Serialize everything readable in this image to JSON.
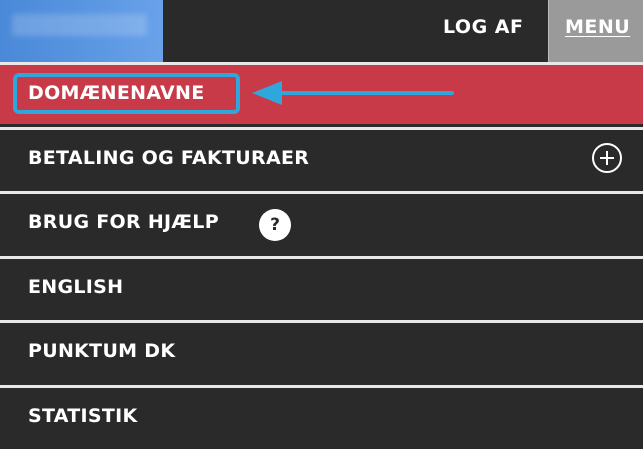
{
  "header": {
    "logout_label": "LOG AF",
    "menu_label": "MENU"
  },
  "nav": {
    "items": [
      {
        "label": "DOMÆNENAVNE",
        "active": true
      },
      {
        "label": "BETALING OG FAKTURAER",
        "expand_icon": "plus-circle-icon"
      },
      {
        "label": "BRUG FOR HJÆLP",
        "help_icon_text": "?"
      },
      {
        "label": "ENGLISH"
      },
      {
        "label": "PUNKTUM DK"
      },
      {
        "label": "STATISTIK"
      }
    ]
  },
  "annotation": {
    "highlight_color": "#2fa7dc",
    "arrow_icon": "left-arrow-icon"
  },
  "colors": {
    "active_bg": "#c83a48",
    "menu_bg": "#2a2a2a",
    "logo_bg": "#4a89d8",
    "menu_button_bg": "#9a9a9a"
  }
}
